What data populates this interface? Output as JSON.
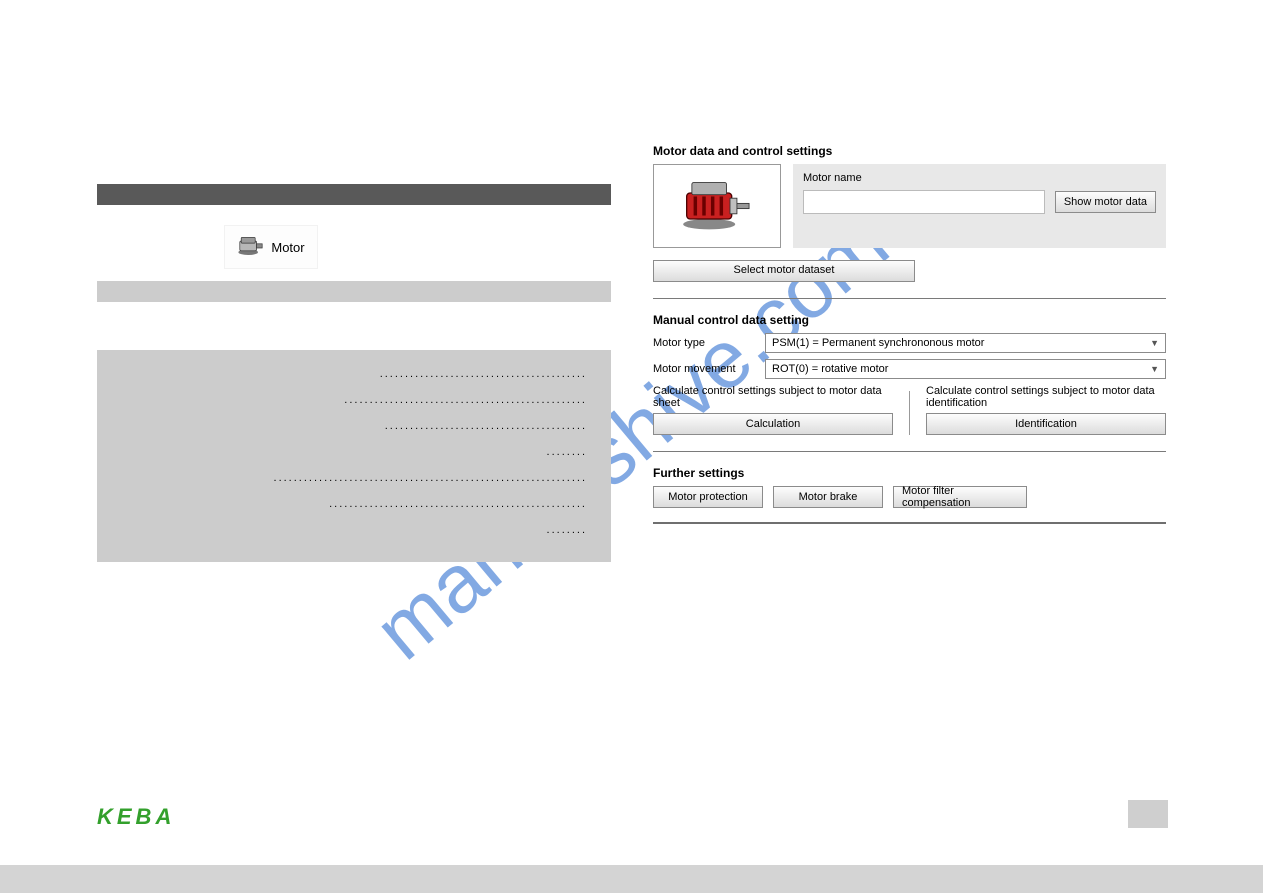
{
  "watermark": "manualshive.com",
  "brand": "KEBA",
  "left": {
    "motor_label": "Motor",
    "dotted_rows": [
      ".........................................",
      "................................................",
      "........................................",
      "........",
      "..............................................................",
      "...................................................",
      "........"
    ]
  },
  "panel": {
    "title": "Motor data and control settings",
    "motor_name_label": "Motor name",
    "motor_name_value": "",
    "show_motor_data_btn": "Show motor data",
    "select_dataset_btn": "Select motor dataset",
    "manual_title": "Manual control data setting",
    "motor_type_label": "Motor type",
    "motor_type_value": "PSM(1) = Permanent synchrononous motor",
    "motor_movement_label": "Motor movement",
    "motor_movement_value": "ROT(0) = rotative motor",
    "calc_hint_left": "Calculate control settings subject to motor data sheet",
    "calc_btn_left": "Calculation",
    "calc_hint_right": "Calculate control settings subject to motor data identification",
    "calc_btn_right": "Identification",
    "further_title": "Further settings",
    "btn_protection": "Motor protection",
    "btn_brake": "Motor brake",
    "btn_filter": "Motor filter compensation"
  }
}
